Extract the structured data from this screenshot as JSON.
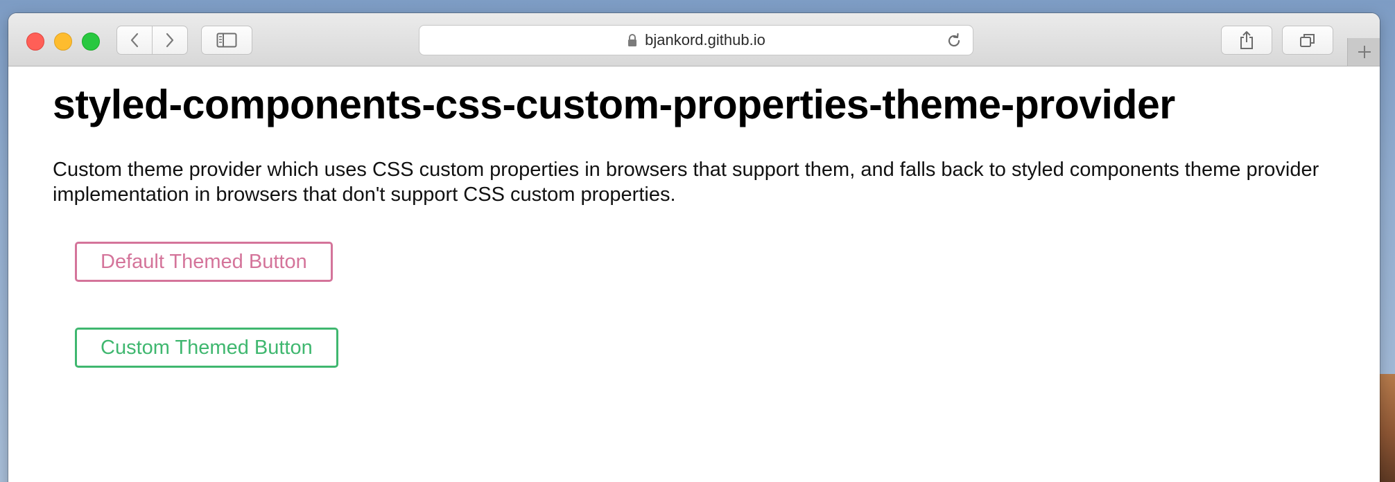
{
  "browser": {
    "url": "bjankord.github.io",
    "icons": {
      "back": "chevron-left-icon",
      "forward": "chevron-right-icon",
      "sidebar": "sidebar-icon",
      "lock": "lock-icon",
      "reload": "reload-icon",
      "share": "share-icon",
      "tabs": "tabs-icon",
      "new_tab": "plus-icon"
    }
  },
  "page": {
    "title": "styled-components-css-custom-properties-theme-provider",
    "description": "Custom theme provider which uses CSS custom properties in browsers that support them, and falls back to styled components theme provider implementation in browsers that don't support CSS custom properties.",
    "buttons": {
      "default_label": "Default Themed Button",
      "custom_label": "Custom Themed Button"
    }
  },
  "colors": {
    "default_theme": "#d4749a",
    "custom_theme": "#3fb76f",
    "close": "#ff5f57",
    "minimize": "#febc2e",
    "maximize": "#28c840"
  }
}
